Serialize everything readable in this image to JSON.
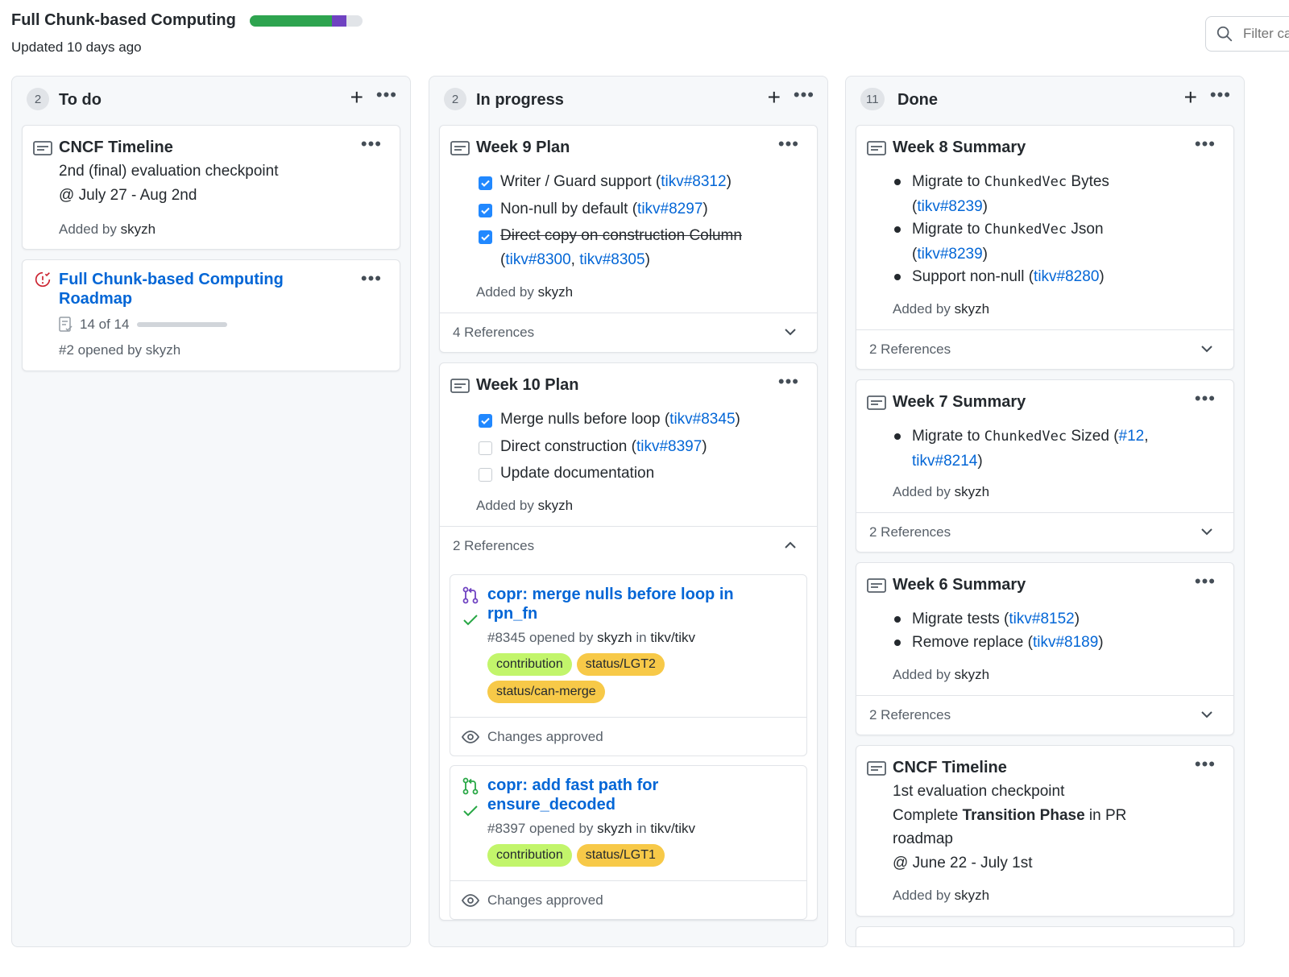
{
  "header": {
    "project_title": "Full Chunk-based Computing",
    "updated": "Updated 10 days ago",
    "progress": {
      "done_percent": 73,
      "in_progress_percent": 13,
      "done_color": "#2ea44f",
      "in_progress_color": "#6f42c1"
    },
    "filter_placeholder": "Filter cards"
  },
  "colors": {
    "accent": "#0366d6",
    "label_contribution": "#c2f56b",
    "label_status": "#f7c948",
    "checkbox": "#2188ff"
  },
  "columns": [
    {
      "count": "2",
      "name": "To do",
      "cards": [
        {
          "title": "CNCF Timeline",
          "lines": [
            "2nd (final) evaluation checkpoint",
            "@ July 27 - Aug 2nd"
          ],
          "added_prefix": "Added by",
          "added_user": "skyzh"
        },
        {
          "issue_title": "Full Chunk-based Computing Roadmap",
          "tasks": "14 of 14",
          "opened": "#2 opened by skyzh"
        }
      ]
    },
    {
      "count": "2",
      "name": "In progress",
      "cards": [
        {
          "title": "Week 9 Plan",
          "items": [
            {
              "text": "Writer / Guard support (",
              "link": "tikv#8312",
              "end": ")"
            },
            {
              "text": "Non-null by default (",
              "link": "tikv#8297",
              "end": ")"
            },
            {
              "text": "Direct copy on construction Column",
              "l2a": "tikv#8300",
              "sep": ", ",
              "l2b": "tikv#8305"
            }
          ],
          "added_prefix": "Added by",
          "added_user": "skyzh",
          "refs": "4 References"
        },
        {
          "title": "Week 10 Plan",
          "items": [
            {
              "text": "Merge nulls before loop (",
              "link": "tikv#8345",
              "end": ")"
            },
            {
              "text": "Direct construction (",
              "link": "tikv#8397",
              "end": ")"
            },
            {
              "text": "Update documentation"
            }
          ],
          "added_prefix": "Added by",
          "added_user": "skyzh",
          "refs": "2 References",
          "prs": [
            {
              "title": "copr: merge nulls before loop in rpn_fn",
              "meta_num": "#8345 opened by",
              "meta_user": "skyzh",
              "meta_in": "in",
              "meta_repo": "tikv/tikv",
              "labels": [
                "contribution",
                "status/LGT2",
                "status/can-merge"
              ],
              "status": "Changes approved"
            },
            {
              "title": "copr: add fast path for ensure_decoded",
              "meta_num": "#8397 opened by",
              "meta_user": "skyzh",
              "meta_in": "in",
              "meta_repo": "tikv/tikv",
              "labels": [
                "contribution",
                "status/LGT1"
              ],
              "status": "Changes approved"
            }
          ]
        }
      ]
    },
    {
      "count": "11",
      "name": "Done",
      "cards": [
        {
          "title": "Week 8 Summary",
          "bullets": [
            {
              "pre": "Migrate to ",
              "code": "ChunkedVec",
              "post": " Bytes",
              "l1": "(",
              "link": "tikv#8239",
              "end": ")"
            },
            {
              "pre": "Migrate to ",
              "code": "ChunkedVec",
              "post": " Json",
              "l1": "(",
              "link": "tikv#8239",
              "end": ")"
            },
            {
              "pre": "Support non-null (",
              "link": "tikv#8280",
              "end": ")"
            }
          ],
          "added_prefix": "Added by",
          "added_user": "skyzh",
          "refs": "2 References"
        },
        {
          "title": "Week 7 Summary",
          "bullets": [
            {
              "pre": "Migrate to ",
              "code": "ChunkedVec",
              "post": " Sized (",
              "link_a": "#12",
              "comma": ",",
              "link": "tikv#8214",
              "end": ")"
            }
          ],
          "added_prefix": "Added by",
          "added_user": "skyzh",
          "refs": "2 References"
        },
        {
          "title": "Week 6 Summary",
          "bullets": [
            {
              "pre": "Migrate tests (",
              "link": "tikv#8152",
              "end": ")"
            },
            {
              "pre": "Remove replace (",
              "link": "tikv#8189",
              "end": ")"
            }
          ],
          "added_prefix": "Added by",
          "added_user": "skyzh",
          "refs": "2 References"
        },
        {
          "title": "CNCF Timeline",
          "line1": "1st evaluation checkpoint",
          "line2_pre": "Complete ",
          "line2_bold": "Transition Phase",
          "line2_post": " in PR",
          "line3": "roadmap",
          "line4": "@ June 22 - July 1st",
          "added_prefix": "Added by",
          "added_user": "skyzh"
        }
      ]
    }
  ]
}
